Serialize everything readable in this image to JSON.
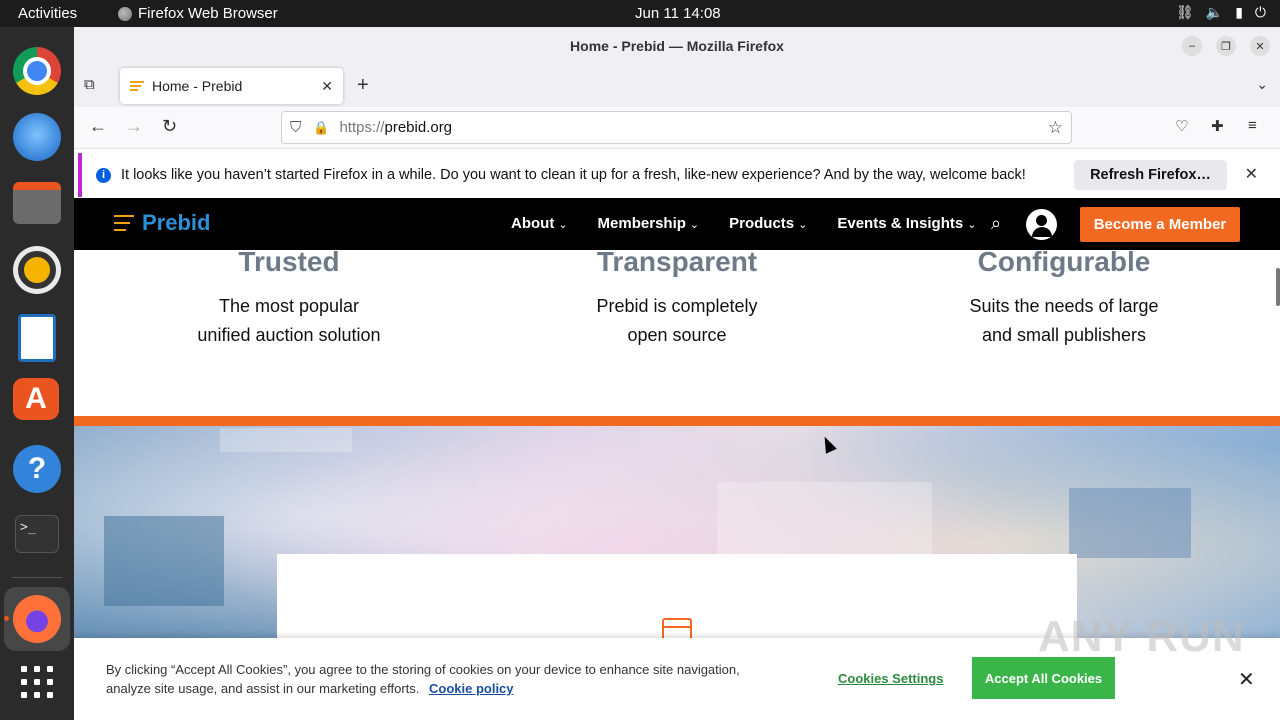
{
  "topbar": {
    "activities": "Activities",
    "app_name": "Firefox Web Browser",
    "clock": "Jun 11  14:08"
  },
  "dock": {
    "items": [
      "chrome-icon",
      "thunderbird-icon",
      "files-icon",
      "rhythmbox-icon",
      "libreoffice-writer-icon",
      "app-center-icon",
      "help-icon",
      "terminal-icon",
      "firefox-icon",
      "show-apps-icon"
    ]
  },
  "window": {
    "title": "Home - Prebid — Mozilla Firefox"
  },
  "tabs": [
    {
      "label": "Home - Prebid"
    }
  ],
  "url": {
    "scheme": "https://",
    "host": "prebid.org"
  },
  "notification": {
    "message": "It looks like you haven’t started Firefox in a while. Do you want to clean it up for a fresh, like-new experience? And by the way, welcome back!",
    "button": "Refresh Firefox…"
  },
  "site": {
    "logo_text": "Prebid",
    "menu": [
      "About",
      "Membership",
      "Products",
      "Events & Insights"
    ],
    "cta": "Become a Member"
  },
  "features": [
    {
      "title": "Trusted",
      "line1": "The most popular",
      "line2": "unified auction solution"
    },
    {
      "title": "Transparent",
      "line1": "Prebid is completely",
      "line2": "open source"
    },
    {
      "title": "Configurable",
      "line1": "Suits the needs of large",
      "line2": "and small publishers"
    }
  ],
  "cookie": {
    "line1": "By clicking “Accept All Cookies”, you agree to the storing of cookies on your device to enhance site navigation,",
    "line2": "analyze site usage, and assist in our marketing efforts.",
    "policy": "Cookie policy",
    "settings": "Cookies Settings",
    "accept": "Accept All Cookies"
  },
  "watermark": "ANY RUN",
  "colors": {
    "prebid_orange": "#f26a21",
    "prebid_blue": "#2d8fd5",
    "accept_green": "#3ab54a"
  }
}
